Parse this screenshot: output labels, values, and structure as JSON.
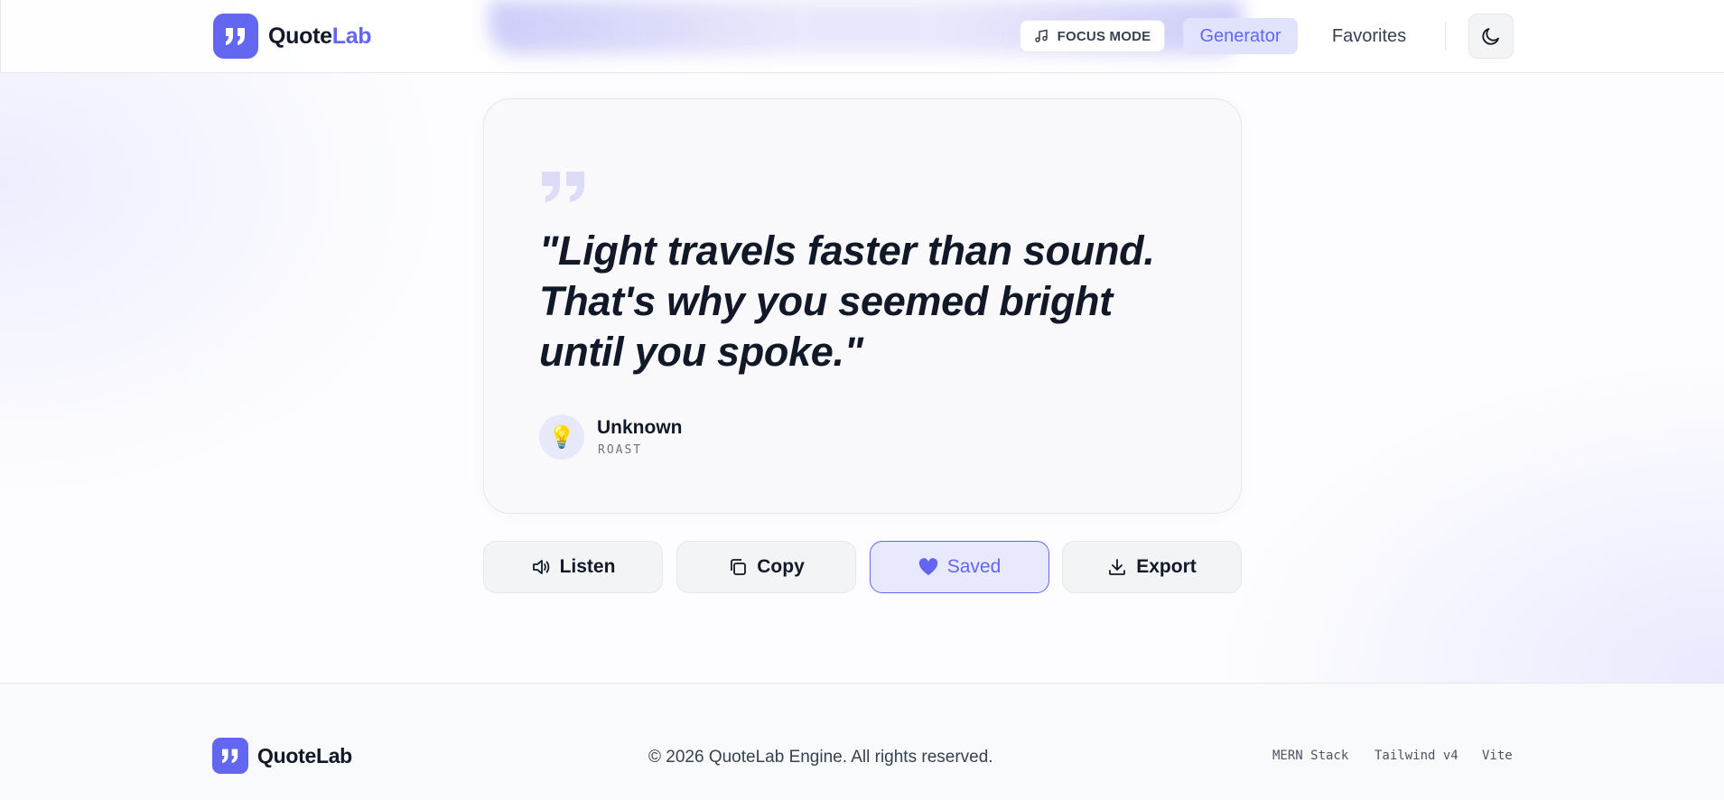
{
  "header": {
    "brand_part1": "Quote",
    "brand_part2": "Lab",
    "focus_mode_label": "FOCUS MODE",
    "nav": {
      "generator": "Generator",
      "favorites": "Favorites"
    },
    "active_nav": "Generator"
  },
  "quote": {
    "text": "\"Light travels faster than sound. That's why you seemed bright until you spoke.\"",
    "author": "Unknown",
    "category": "ROAST",
    "avatar_emoji": "💡"
  },
  "actions": {
    "listen": "Listen",
    "copy": "Copy",
    "saved": "Saved",
    "export": "Export"
  },
  "footer": {
    "brand": "QuoteLab",
    "copyright": "© 2026 QuoteLab Engine. All rights reserved.",
    "tech": [
      "MERN Stack",
      "Tailwind v4",
      "Vite"
    ]
  },
  "colors": {
    "accent": "#6366f1",
    "text": "#111827"
  }
}
